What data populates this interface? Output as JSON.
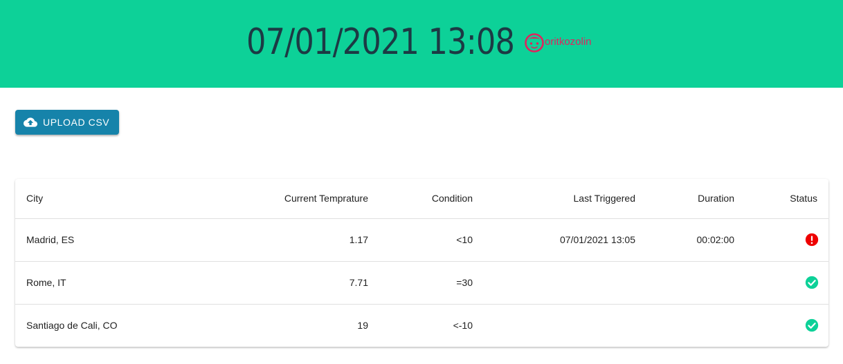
{
  "header": {
    "clock": "07/01/2021 13:08",
    "username": "oritkozolin",
    "user_icon": "face-icon",
    "background_color": "#0dd198",
    "username_color": "#e0245e"
  },
  "toolbar": {
    "upload_label": "UPLOAD CSV",
    "upload_icon": "cloud-upload-icon",
    "button_color": "#1683aa"
  },
  "table": {
    "columns": [
      "City",
      "Current Temprature",
      "Condition",
      "Last Triggered",
      "Duration",
      "Status"
    ],
    "rows": [
      {
        "city": "Madrid, ES",
        "temperature": "1.17",
        "condition": "<10",
        "last_triggered": "07/01/2021 13:05",
        "duration": "00:02:00",
        "status": "alert",
        "status_icon": "error-icon",
        "status_color": "#ee0000"
      },
      {
        "city": "Rome, IT",
        "temperature": "7.71",
        "condition": "=30",
        "last_triggered": "",
        "duration": "",
        "status": "ok",
        "status_icon": "check-circle-icon",
        "status_color": "#0dd198"
      },
      {
        "city": "Santiago de Cali, CO",
        "temperature": "19",
        "condition": "<-10",
        "last_triggered": "",
        "duration": "",
        "status": "ok",
        "status_icon": "check-circle-icon",
        "status_color": "#0dd198"
      }
    ]
  }
}
